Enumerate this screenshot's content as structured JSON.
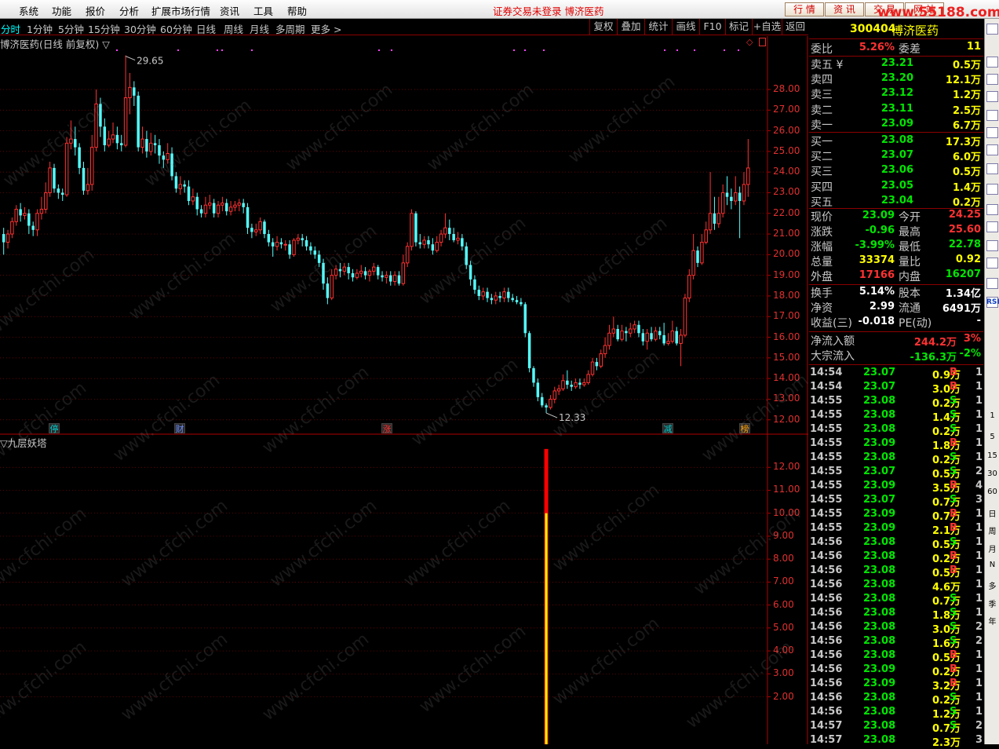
{
  "menu": {
    "items": [
      "系统",
      "功能",
      "报价",
      "分析",
      "扩展市场行情",
      "资讯",
      "工具",
      "帮助"
    ],
    "notice": "证券交易未登录  博济医药",
    "buttons": [
      "行 情",
      "资 讯",
      "交 易",
      "网 站"
    ],
    "watermark_url": "www.55188.com"
  },
  "periods": {
    "items": [
      "分时",
      "1分钟",
      "5分钟",
      "15分钟",
      "30分钟",
      "60分钟",
      "日线",
      "周线",
      "月线",
      "多周期",
      "更多 >"
    ],
    "active": "分时"
  },
  "toolbar": {
    "items": [
      "复权",
      "叠加",
      "统计",
      "画线",
      "F10",
      "标记",
      "+自选",
      "返回"
    ]
  },
  "chart_title": "博济医药(日线 前复权) ▽",
  "indicator_title": "▽九层妖塔",
  "watermark_text": "www.cfchi.com",
  "chart_data": {
    "type": "candlestick",
    "price_ticks": [
      "28.00",
      "27.00",
      "26.00",
      "25.00",
      "24.00",
      "23.00",
      "22.00",
      "21.00",
      "20.00",
      "19.00",
      "18.00",
      "17.00",
      "16.00",
      "15.00",
      "14.00",
      "13.00",
      "12.00"
    ],
    "indicator_ticks": [
      "12.00",
      "11.00",
      "10.00",
      "9.00",
      "8.00",
      "7.00",
      "6.00",
      "5.00",
      "4.00",
      "3.00",
      "2.00"
    ],
    "high_label": "29.65",
    "low_label": "12.33",
    "ylim": [
      11.8,
      29.9
    ],
    "indicator_ylim": [
      0,
      13
    ],
    "indicator_bar": {
      "value_red": 12.8,
      "value_yellow": 10.0
    },
    "markers": [
      {
        "text": "停",
        "color": "#00c8c8"
      },
      {
        "text": "财",
        "color": "#6a8cff"
      },
      {
        "text": "涨",
        "color": "#ff3030"
      },
      {
        "text": "减",
        "color": "#00c8c8"
      },
      {
        "text": "榜",
        "color": "#ffa000"
      }
    ],
    "candles": [
      [
        21.0,
        20.6,
        21.3,
        20.0
      ],
      [
        20.6,
        21.0,
        21.2,
        20.3
      ],
      [
        21.0,
        21.6,
        21.8,
        20.8
      ],
      [
        21.6,
        22.2,
        22.4,
        21.4
      ],
      [
        22.2,
        21.9,
        22.5,
        21.6
      ],
      [
        21.9,
        22.0,
        22.3,
        21.7
      ],
      [
        22.0,
        21.4,
        22.2,
        21.0
      ],
      [
        21.4,
        21.2,
        21.6,
        20.9
      ],
      [
        21.2,
        22.0,
        22.2,
        20.9
      ],
      [
        22.0,
        22.2,
        22.8,
        21.7
      ],
      [
        22.2,
        23.0,
        23.5,
        22.0
      ],
      [
        23.0,
        24.2,
        24.5,
        22.8
      ],
      [
        24.2,
        23.2,
        24.4,
        23.0
      ],
      [
        23.2,
        23.0,
        23.4,
        22.7
      ],
      [
        23.0,
        22.9,
        23.2,
        22.6
      ],
      [
        22.9,
        25.4,
        25.7,
        22.8
      ],
      [
        25.4,
        25.6,
        26.5,
        25.1
      ],
      [
        25.6,
        25.2,
        26.2,
        24.8
      ],
      [
        25.2,
        24.2,
        25.4,
        23.9
      ],
      [
        24.2,
        23.1,
        24.5,
        22.9
      ],
      [
        23.1,
        23.4,
        24.2,
        22.9
      ],
      [
        23.4,
        25.2,
        25.8,
        23.1
      ],
      [
        25.2,
        27.3,
        28.0,
        25.0
      ],
      [
        27.3,
        26.2,
        27.6,
        25.7
      ],
      [
        26.2,
        25.3,
        26.6,
        25.0
      ],
      [
        25.3,
        25.6,
        26.0,
        25.2
      ],
      [
        25.6,
        25.8,
        26.4,
        25.4
      ],
      [
        25.8,
        25.4,
        26.2,
        25.1
      ],
      [
        25.4,
        25.3,
        25.8,
        25.0
      ],
      [
        25.3,
        27.6,
        29.65,
        25.2
      ],
      [
        27.6,
        28.1,
        28.8,
        26.8
      ],
      [
        28.1,
        27.7,
        28.4,
        27.2
      ],
      [
        27.7,
        25.2,
        27.9,
        25.0
      ],
      [
        25.2,
        25.6,
        26.2,
        24.9
      ],
      [
        25.6,
        25.0,
        26.0,
        24.7
      ],
      [
        25.0,
        25.4,
        25.9,
        24.8
      ],
      [
        25.4,
        25.3,
        25.8,
        24.9
      ],
      [
        25.3,
        24.8,
        25.6,
        24.4
      ],
      [
        24.8,
        24.6,
        25.0,
        24.2
      ],
      [
        24.6,
        24.9,
        25.4,
        24.4
      ],
      [
        24.9,
        23.8,
        25.2,
        23.6
      ],
      [
        23.8,
        23.2,
        24.0,
        23.0
      ],
      [
        23.2,
        23.4,
        23.8,
        22.9
      ],
      [
        23.4,
        23.3,
        23.6,
        23.0
      ],
      [
        23.3,
        22.6,
        23.6,
        22.4
      ],
      [
        22.6,
        22.8,
        23.2,
        22.4
      ],
      [
        22.8,
        22.2,
        23.0,
        21.9
      ],
      [
        22.2,
        22.0,
        22.4,
        21.8
      ],
      [
        22.0,
        22.4,
        22.8,
        21.8
      ],
      [
        22.4,
        22.5,
        22.9,
        22.2
      ],
      [
        22.5,
        22.0,
        22.7,
        21.8
      ],
      [
        22.0,
        22.4,
        22.6,
        21.8
      ],
      [
        22.4,
        22.5,
        22.8,
        22.1
      ],
      [
        22.5,
        22.1,
        22.7,
        21.9
      ],
      [
        22.1,
        22.3,
        22.6,
        21.9
      ],
      [
        22.3,
        22.4,
        22.6,
        22.1
      ],
      [
        22.4,
        22.5,
        22.7,
        22.1
      ],
      [
        22.5,
        22.3,
        22.7,
        22.0
      ],
      [
        22.3,
        21.3,
        22.5,
        21.0
      ],
      [
        21.3,
        21.1,
        21.5,
        20.8
      ],
      [
        21.1,
        21.2,
        21.5,
        20.9
      ],
      [
        21.2,
        21.6,
        21.8,
        21.0
      ],
      [
        21.6,
        21.0,
        21.7,
        20.8
      ],
      [
        21.0,
        20.6,
        21.2,
        20.4
      ],
      [
        20.6,
        20.4,
        20.8,
        19.9
      ],
      [
        20.4,
        20.6,
        20.9,
        20.2
      ],
      [
        20.6,
        20.5,
        20.8,
        20.3
      ],
      [
        20.5,
        20.5,
        20.7,
        20.2
      ],
      [
        20.5,
        20.0,
        20.7,
        19.8
      ],
      [
        20.0,
        20.7,
        20.8,
        19.9
      ],
      [
        20.7,
        20.8,
        21.0,
        20.5
      ],
      [
        20.8,
        20.7,
        21.0,
        20.4
      ],
      [
        20.7,
        20.4,
        20.9,
        20.2
      ],
      [
        20.4,
        20.2,
        20.6,
        20.0
      ],
      [
        20.2,
        20.0,
        20.4,
        19.8
      ],
      [
        20.0,
        19.6,
        20.2,
        19.4
      ],
      [
        19.6,
        18.6,
        19.8,
        18.3
      ],
      [
        18.6,
        17.9,
        18.9,
        17.6
      ],
      [
        17.9,
        19.0,
        19.3,
        17.8
      ],
      [
        19.0,
        19.3,
        19.5,
        18.8
      ],
      [
        19.3,
        19.2,
        19.6,
        18.9
      ],
      [
        19.2,
        19.4,
        19.6,
        19.0
      ],
      [
        19.4,
        19.1,
        19.6,
        18.8
      ],
      [
        19.1,
        18.9,
        19.3,
        18.7
      ],
      [
        18.9,
        19.1,
        19.3,
        18.8
      ],
      [
        19.1,
        19.2,
        19.5,
        18.9
      ],
      [
        19.2,
        19.0,
        19.4,
        18.8
      ],
      [
        19.0,
        19.2,
        19.3,
        18.7
      ],
      [
        19.2,
        19.4,
        19.6,
        19.0
      ],
      [
        19.4,
        19.0,
        19.5,
        18.8
      ],
      [
        19.0,
        18.9,
        19.2,
        18.7
      ],
      [
        18.9,
        19.0,
        19.2,
        18.6
      ],
      [
        19.0,
        18.7,
        19.2,
        18.5
      ],
      [
        18.7,
        19.0,
        19.2,
        18.5
      ],
      [
        19.0,
        18.6,
        19.2,
        18.5
      ],
      [
        18.6,
        19.6,
        20.0,
        18.5
      ],
      [
        19.6,
        20.4,
        20.6,
        19.4
      ],
      [
        20.4,
        22.0,
        22.2,
        20.2
      ],
      [
        22.0,
        20.6,
        22.1,
        20.4
      ],
      [
        20.6,
        20.5,
        21.0,
        20.3
      ],
      [
        20.5,
        20.7,
        20.9,
        20.3
      ],
      [
        20.7,
        20.5,
        20.9,
        20.3
      ],
      [
        20.5,
        20.2,
        20.8,
        20.0
      ],
      [
        20.2,
        20.6,
        20.9,
        20.1
      ],
      [
        20.6,
        21.0,
        21.2,
        20.4
      ],
      [
        21.0,
        21.3,
        22.0,
        20.8
      ],
      [
        21.3,
        21.0,
        21.7,
        20.7
      ],
      [
        21.0,
        20.7,
        21.3,
        20.6
      ],
      [
        20.7,
        20.8,
        21.1,
        20.5
      ],
      [
        20.8,
        20.4,
        21.0,
        20.2
      ],
      [
        20.4,
        19.5,
        20.6,
        19.3
      ],
      [
        19.5,
        18.8,
        19.7,
        18.5
      ],
      [
        18.8,
        18.3,
        19.0,
        18.1
      ],
      [
        18.3,
        18.0,
        18.5,
        17.8
      ],
      [
        18.0,
        18.2,
        18.4,
        17.8
      ],
      [
        18.2,
        17.9,
        18.4,
        17.7
      ],
      [
        17.9,
        17.8,
        18.1,
        17.6
      ],
      [
        17.8,
        18.0,
        18.2,
        17.6
      ],
      [
        18.0,
        17.9,
        18.2,
        17.7
      ],
      [
        17.9,
        18.2,
        18.4,
        17.7
      ],
      [
        18.2,
        17.9,
        18.4,
        17.7
      ],
      [
        17.9,
        17.8,
        18.1,
        17.7
      ],
      [
        17.8,
        17.7,
        18.0,
        17.6
      ],
      [
        17.7,
        17.6,
        17.9,
        17.5
      ],
      [
        17.6,
        16.2,
        17.7,
        16.0
      ],
      [
        16.2,
        14.5,
        16.3,
        14.3
      ],
      [
        14.5,
        13.8,
        14.6,
        13.6
      ],
      [
        13.8,
        13.1,
        14.0,
        12.9
      ],
      [
        13.1,
        12.7,
        13.3,
        12.6
      ],
      [
        12.7,
        12.6,
        12.8,
        12.33
      ],
      [
        12.6,
        13.0,
        13.2,
        12.5
      ],
      [
        13.0,
        13.4,
        13.6,
        12.8
      ],
      [
        13.4,
        13.5,
        13.7,
        13.2
      ],
      [
        13.5,
        13.9,
        14.2,
        13.4
      ],
      [
        13.9,
        13.7,
        14.4,
        13.5
      ],
      [
        13.7,
        13.6,
        13.9,
        13.4
      ],
      [
        13.6,
        13.8,
        14.0,
        13.5
      ],
      [
        13.8,
        13.7,
        14.0,
        13.5
      ],
      [
        13.7,
        13.8,
        14.0,
        13.6
      ],
      [
        13.8,
        14.2,
        14.4,
        13.7
      ],
      [
        14.2,
        14.8,
        15.0,
        14.1
      ],
      [
        14.8,
        14.6,
        15.0,
        14.4
      ],
      [
        14.6,
        15.2,
        15.4,
        14.5
      ],
      [
        15.2,
        15.6,
        16.0,
        15.0
      ],
      [
        15.6,
        16.2,
        16.6,
        15.4
      ],
      [
        16.2,
        16.4,
        17.0,
        16.0
      ],
      [
        16.4,
        15.9,
        16.6,
        15.8
      ],
      [
        15.9,
        16.3,
        16.6,
        15.8
      ],
      [
        16.3,
        16.2,
        16.5,
        15.8
      ],
      [
        16.2,
        16.4,
        16.7,
        16.0
      ],
      [
        16.4,
        16.6,
        16.8,
        16.2
      ],
      [
        16.6,
        16.2,
        16.8,
        16.0
      ],
      [
        16.2,
        15.8,
        16.4,
        15.6
      ],
      [
        15.8,
        16.2,
        16.4,
        15.4
      ],
      [
        16.2,
        15.9,
        16.5,
        15.8
      ],
      [
        15.9,
        16.3,
        16.5,
        15.8
      ],
      [
        16.3,
        16.1,
        16.5,
        15.9
      ],
      [
        16.1,
        15.7,
        16.7,
        15.6
      ],
      [
        15.7,
        15.8,
        16.2,
        15.6
      ],
      [
        15.8,
        16.3,
        16.8,
        15.7
      ],
      [
        16.3,
        15.7,
        16.5,
        15.6
      ],
      [
        15.7,
        16.1,
        16.4,
        14.6
      ],
      [
        16.1,
        17.9,
        18.1,
        16.0
      ],
      [
        17.9,
        19.0,
        19.3,
        17.7
      ],
      [
        19.0,
        20.2,
        21.0,
        18.8
      ],
      [
        20.2,
        19.6,
        20.4,
        19.4
      ],
      [
        19.6,
        20.6,
        21.0,
        19.5
      ],
      [
        20.6,
        21.2,
        21.6,
        20.5
      ],
      [
        21.2,
        22.0,
        24.0,
        21.0
      ],
      [
        22.0,
        21.5,
        22.8,
        21.2
      ],
      [
        21.5,
        22.0,
        22.8,
        21.3
      ],
      [
        22.0,
        23.0,
        23.4,
        21.8
      ],
      [
        23.0,
        22.8,
        23.8,
        22.4
      ],
      [
        22.8,
        22.6,
        23.2,
        22.2
      ],
      [
        22.6,
        23.0,
        23.8,
        22.4
      ],
      [
        23.0,
        22.6,
        23.3,
        20.8
      ],
      [
        22.6,
        23.4,
        24.0,
        22.4
      ],
      [
        23.4,
        24.2,
        25.6,
        22.8
      ]
    ]
  },
  "stock": {
    "code": "300404",
    "name": "博济医药"
  },
  "committee": {
    "label1": "委比",
    "value1": "5.26%",
    "label2": "委差",
    "value2": "11"
  },
  "sell_orders": [
    {
      "label": "卖五 ¥",
      "price": "23.21",
      "vol": "0.5万"
    },
    {
      "label": "卖四",
      "price": "23.20",
      "vol": "12.1万"
    },
    {
      "label": "卖三",
      "price": "23.12",
      "vol": "1.2万"
    },
    {
      "label": "卖二",
      "price": "23.11",
      "vol": "2.5万"
    },
    {
      "label": "卖一",
      "price": "23.09",
      "vol": "6.7万"
    }
  ],
  "buy_orders": [
    {
      "label": "买一",
      "price": "23.08",
      "vol": "17.3万"
    },
    {
      "label": "买二",
      "price": "23.07",
      "vol": "6.0万"
    },
    {
      "label": "买三",
      "price": "23.06",
      "vol": "0.5万"
    },
    {
      "label": "买四",
      "price": "23.05",
      "vol": "1.4万"
    },
    {
      "label": "买五",
      "price": "23.04",
      "vol": "0.2万"
    }
  ],
  "stats": [
    {
      "l1": "现价",
      "v1": "23.09",
      "c1": "grn",
      "l2": "今开",
      "v2": "24.25",
      "c2": "red"
    },
    {
      "l1": "涨跌",
      "v1": "-0.96",
      "c1": "grn",
      "l2": "最高",
      "v2": "25.60",
      "c2": "red"
    },
    {
      "l1": "涨幅",
      "v1": "-3.99%",
      "c1": "grn",
      "l2": "最低",
      "v2": "22.78",
      "c2": "grn"
    },
    {
      "l1": "总量",
      "v1": "33374",
      "c1": "yel",
      "l2": "量比",
      "v2": "0.92",
      "c2": "yel"
    },
    {
      "l1": "外盘",
      "v1": "17166",
      "c1": "red",
      "l2": "内盘",
      "v2": "16207",
      "c2": "grn"
    }
  ],
  "stats2": [
    {
      "l1": "换手",
      "v1": "5.14%",
      "l2": "股本",
      "v2": "1.34亿"
    },
    {
      "l1": "净资",
      "v1": "2.99",
      "l2": "流通",
      "v2": "6491万"
    },
    {
      "l1": "收益(三)",
      "v1": "-0.018",
      "l2": "PE(动)",
      "v2": "-"
    }
  ],
  "flow": [
    {
      "label": "净流入额",
      "value": "244.2万",
      "pct": "3%",
      "color": "red"
    },
    {
      "label": "大宗流入",
      "value": "-136.3万",
      "pct": "-2%",
      "color": "grn"
    }
  ],
  "ticks": [
    [
      "14:54",
      "23.07",
      "0.9万",
      "B",
      "1"
    ],
    [
      "14:54",
      "23.07",
      "3.0万",
      "B",
      "1"
    ],
    [
      "14:55",
      "23.08",
      "0.2万",
      "S",
      "1"
    ],
    [
      "14:55",
      "23.08",
      "1.4万",
      "S",
      "1"
    ],
    [
      "14:55",
      "23.08",
      "0.2万",
      "S",
      "1"
    ],
    [
      "14:55",
      "23.09",
      "1.8万",
      "B",
      "1"
    ],
    [
      "14:55",
      "23.08",
      "0.2万",
      "S",
      "1"
    ],
    [
      "14:55",
      "23.07",
      "0.5万",
      "S",
      "2"
    ],
    [
      "14:55",
      "23.09",
      "3.5万",
      "B",
      "4"
    ],
    [
      "14:55",
      "23.07",
      "0.7万",
      "S",
      "3"
    ],
    [
      "14:55",
      "23.09",
      "0.7万",
      "B",
      "1"
    ],
    [
      "14:55",
      "23.09",
      "2.1万",
      "B",
      "1"
    ],
    [
      "14:56",
      "23.08",
      "0.5万",
      "S",
      "1"
    ],
    [
      "14:56",
      "23.08",
      "0.2万",
      "B",
      "1"
    ],
    [
      "14:56",
      "23.08",
      "0.5万",
      "B",
      "1"
    ],
    [
      "14:56",
      "23.08",
      "4.6万",
      "",
      "1"
    ],
    [
      "14:56",
      "23.08",
      "0.7万",
      "S",
      "1"
    ],
    [
      "14:56",
      "23.08",
      "1.8万",
      "S",
      "1"
    ],
    [
      "14:56",
      "23.08",
      "3.0万",
      "S",
      "2"
    ],
    [
      "14:56",
      "23.08",
      "1.6万",
      "S",
      "2"
    ],
    [
      "14:56",
      "23.08",
      "0.5万",
      "B",
      "1"
    ],
    [
      "14:56",
      "23.09",
      "0.2万",
      "B",
      "1"
    ],
    [
      "14:56",
      "23.09",
      "3.2万",
      "B",
      "1"
    ],
    [
      "14:56",
      "23.08",
      "0.2万",
      "S",
      "1"
    ],
    [
      "14:56",
      "23.08",
      "1.2万",
      "S",
      "1"
    ],
    [
      "14:57",
      "23.08",
      "0.7万",
      "S",
      "2"
    ],
    [
      "14:57",
      "23.08",
      "2.3万",
      "",
      "3"
    ]
  ],
  "sidebar": {
    "items": [
      "RSI",
      "1",
      "5",
      "15",
      "30",
      "60",
      "日",
      "周",
      "月",
      "N",
      "多",
      "季",
      "年"
    ]
  },
  "colors": {
    "up": "#ff3232",
    "down": "#54ffff",
    "grid": "#b00000",
    "yellow": "#ffff00",
    "green": "#00e600"
  }
}
